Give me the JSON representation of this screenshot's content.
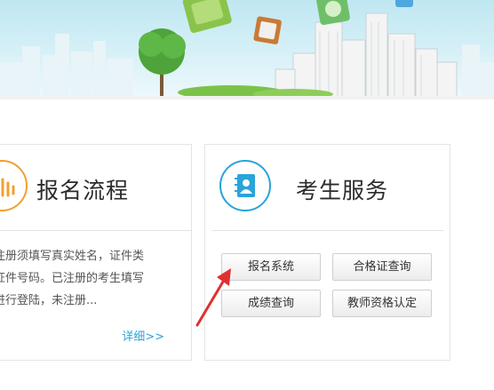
{
  "left_card": {
    "title": "报名流程",
    "icon": "hand-icon",
    "notice_lines": [
      "注册须填写真实姓名，证件类",
      "证件号码。已注册的考生填写",
      "进行登陆，未注册..."
    ],
    "more_label": "详细>>"
  },
  "right_card": {
    "title": "考生服务",
    "icon": "contact-book-icon",
    "buttons": [
      "报名系统",
      "合格证查询",
      "成绩查询",
      "教师资格认定"
    ]
  },
  "colors": {
    "accent_blue": "#2aa4d9",
    "accent_orange": "#f0a030",
    "arrow_red": "#e03030"
  }
}
